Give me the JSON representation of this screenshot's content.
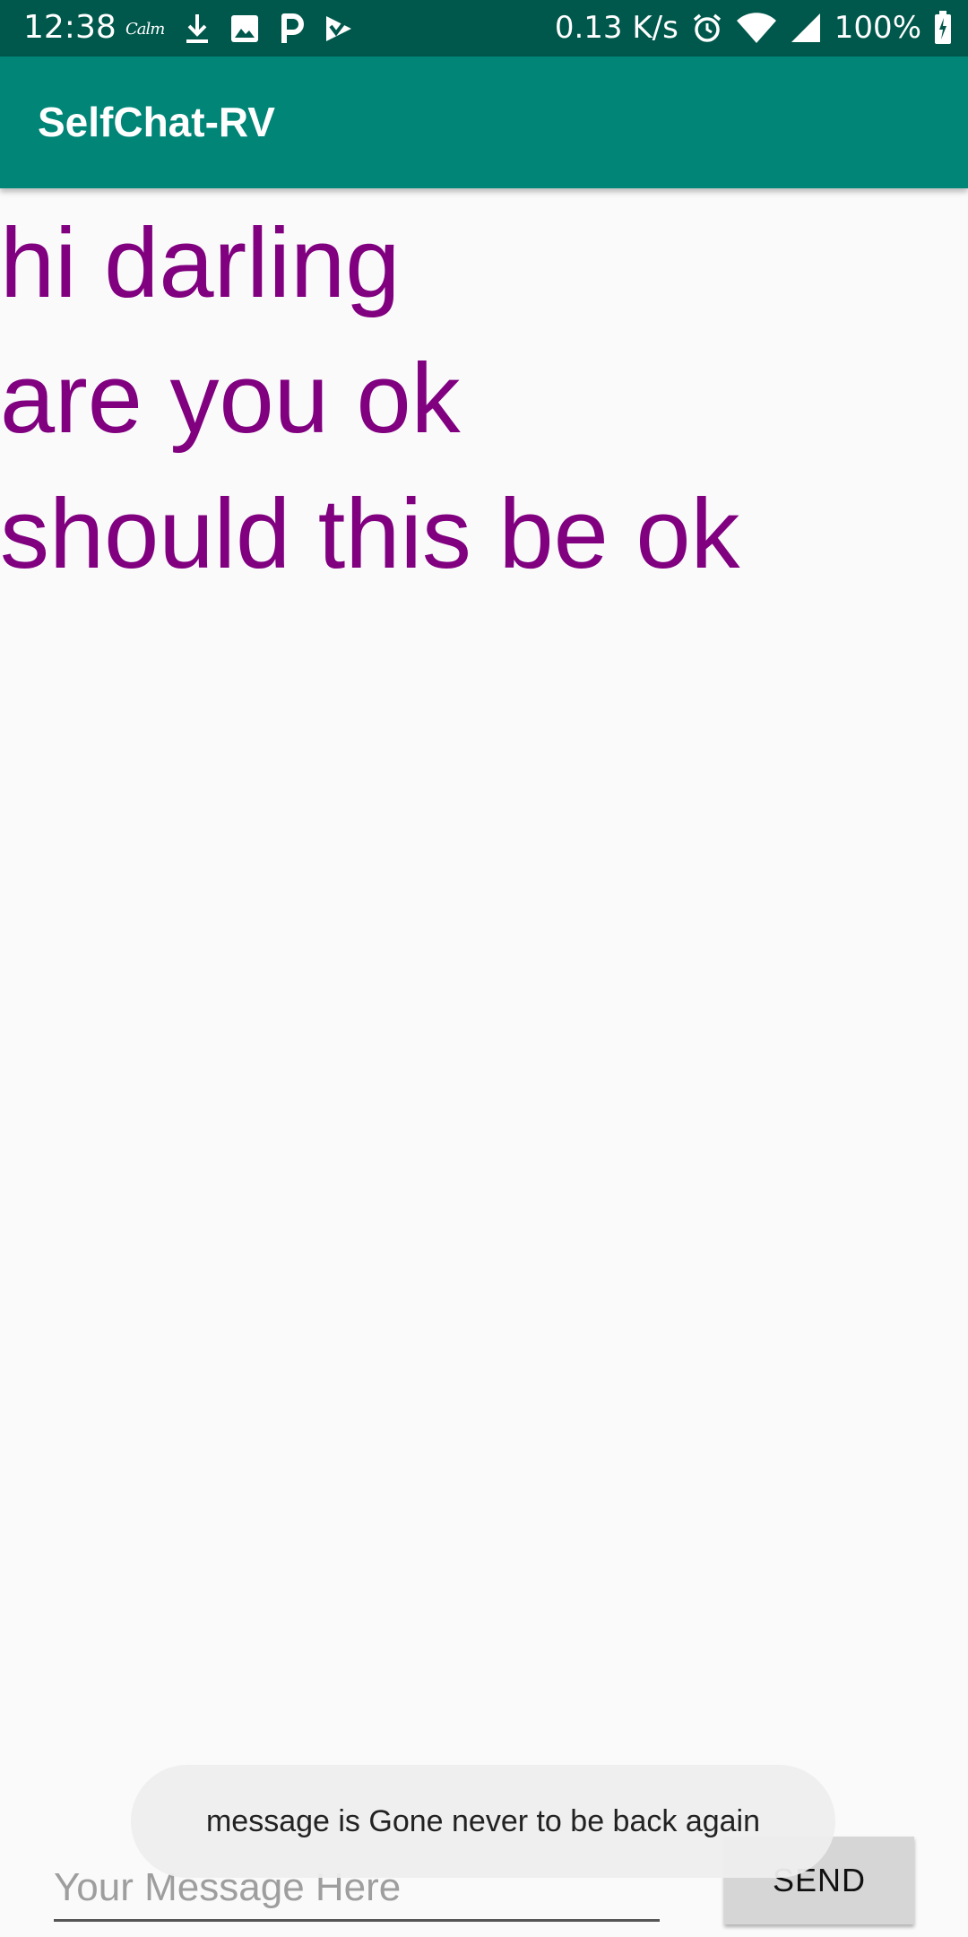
{
  "status_bar": {
    "time": "12:38",
    "calm_icon_text": "Calm",
    "network_speed": "0.13 K/s",
    "battery": "100%",
    "icons": [
      "calm-icon",
      "download-icon",
      "image-icon",
      "p-icon",
      "play-store-icon",
      "alarm-icon",
      "wifi-icon",
      "signal-icon",
      "battery-icon"
    ]
  },
  "app_bar": {
    "title": "SelfChat-RV"
  },
  "messages": [
    {
      "text": "hi darling"
    },
    {
      "text": "are you ok"
    },
    {
      "text": "should this be ok"
    }
  ],
  "colors": {
    "status_bar": "#00574b",
    "app_bar": "#008577",
    "message_text": "#800080",
    "background": "#fafafa"
  },
  "composer": {
    "placeholder": "Your Message Here",
    "value": "",
    "send_label": "SEND"
  },
  "toast": {
    "text": "message is Gone never to be back again"
  }
}
